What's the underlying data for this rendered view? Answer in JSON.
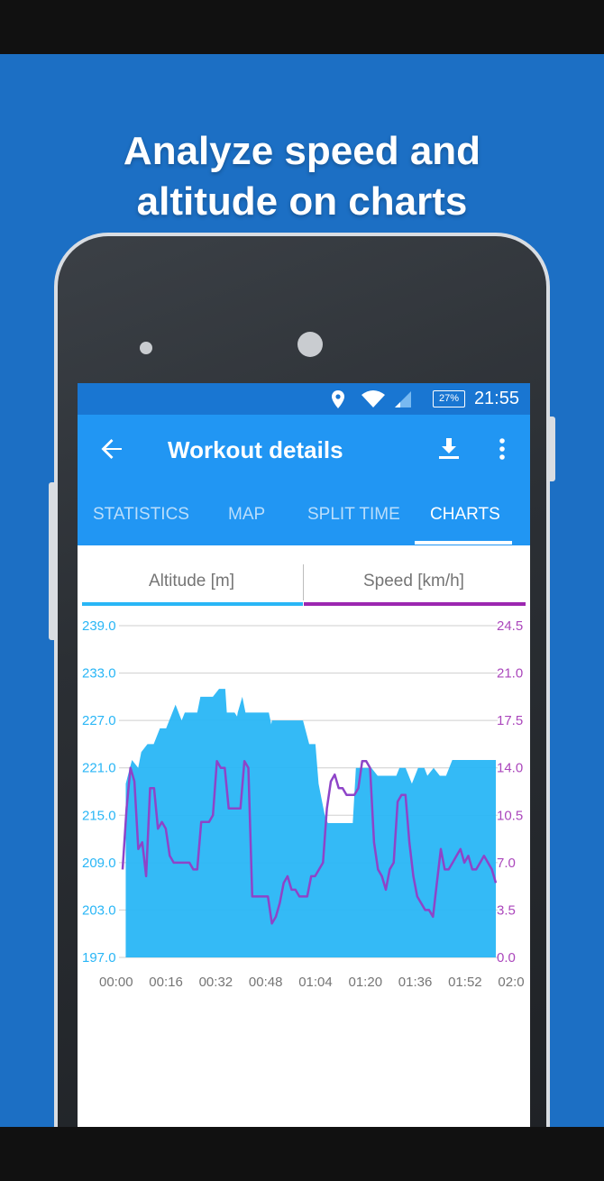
{
  "promo": {
    "headline_line1": "Analyze speed and",
    "headline_line2": "altitude on charts"
  },
  "status_bar": {
    "battery": "27%",
    "time": "21:55"
  },
  "app_bar": {
    "title": "Workout details",
    "tabs": [
      {
        "label": "STATISTICS",
        "active": false
      },
      {
        "label": "MAP",
        "active": false
      },
      {
        "label": "SPLIT TIME",
        "active": false
      },
      {
        "label": "CHARTS",
        "active": true
      }
    ]
  },
  "chart_toggle": {
    "altitude_label": "Altitude [m]",
    "speed_label": "Speed [km/h]"
  },
  "colors": {
    "brand": "#1c6fc4",
    "app_bar": "#2196f3",
    "altitude": "#29b6f6",
    "speed": "#9c27b0"
  },
  "chart_data": {
    "type": "area",
    "title": "",
    "x_ticks": [
      "00:00",
      "00:16",
      "00:32",
      "00:48",
      "01:04",
      "01:20",
      "01:36",
      "01:52",
      "02:0"
    ],
    "y_left_ticks": [
      "239.0",
      "233.0",
      "227.0",
      "221.0",
      "215.0",
      "209.0",
      "203.0",
      "197.0"
    ],
    "y_right_ticks": [
      "24.5",
      "21.0",
      "17.5",
      "14.0",
      "10.5",
      "7.0",
      "3.5",
      "0.0"
    ],
    "y_left_range": [
      197,
      239
    ],
    "y_right_range": [
      0,
      24.5
    ],
    "x_range_minutes": [
      0,
      120
    ],
    "grid": true,
    "series": [
      {
        "name": "Altitude [m]",
        "axis": "left",
        "kind": "area",
        "points": [
          [
            1,
            219
          ],
          [
            3,
            222
          ],
          [
            5,
            221
          ],
          [
            6,
            223
          ],
          [
            8,
            224
          ],
          [
            10,
            224
          ],
          [
            12,
            226
          ],
          [
            14,
            226
          ],
          [
            17,
            229
          ],
          [
            19,
            227
          ],
          [
            20,
            228
          ],
          [
            22,
            228
          ],
          [
            24,
            228
          ],
          [
            25,
            230
          ],
          [
            27,
            230
          ],
          [
            29,
            230
          ],
          [
            31,
            231
          ],
          [
            33,
            231
          ],
          [
            33.5,
            228
          ],
          [
            36,
            228
          ],
          [
            36.8,
            227.5
          ],
          [
            37,
            228
          ],
          [
            38.5,
            230
          ],
          [
            39.5,
            228
          ],
          [
            42,
            228
          ],
          [
            44,
            228
          ],
          [
            46,
            228
          ],
          [
            47,
            228
          ],
          [
            47.8,
            226.5
          ],
          [
            48,
            227
          ],
          [
            50,
            227
          ],
          [
            52,
            227
          ],
          [
            54,
            227
          ],
          [
            55,
            227
          ],
          [
            58,
            227
          ],
          [
            60,
            224
          ],
          [
            62,
            224
          ],
          [
            63,
            219
          ],
          [
            64,
            217
          ],
          [
            65,
            215
          ],
          [
            66,
            214
          ],
          [
            68,
            214
          ],
          [
            70,
            214
          ],
          [
            72,
            214
          ],
          [
            74,
            214
          ],
          [
            75,
            221
          ],
          [
            77,
            221
          ],
          [
            80,
            221
          ],
          [
            82,
            220
          ],
          [
            84,
            220
          ],
          [
            86,
            220
          ],
          [
            88,
            220
          ],
          [
            89,
            221
          ],
          [
            91,
            221
          ],
          [
            92,
            220
          ],
          [
            93,
            219
          ],
          [
            95,
            221
          ],
          [
            97,
            221
          ],
          [
            98,
            220
          ],
          [
            100,
            221
          ],
          [
            102,
            220
          ],
          [
            104,
            220
          ],
          [
            106,
            222
          ],
          [
            110,
            222
          ],
          [
            120,
            222
          ]
        ]
      },
      {
        "name": "Speed [km/h]",
        "axis": "right",
        "kind": "line",
        "points": [
          [
            0,
            6.5
          ],
          [
            1,
            11
          ],
          [
            2,
            14
          ],
          [
            3,
            13
          ],
          [
            4,
            8
          ],
          [
            5,
            8.5
          ],
          [
            6,
            6
          ],
          [
            7,
            12.5
          ],
          [
            9,
            12.5
          ],
          [
            10,
            9.5
          ],
          [
            11,
            10
          ],
          [
            12,
            9.5
          ],
          [
            13,
            7.5
          ],
          [
            15,
            7
          ],
          [
            17,
            7
          ],
          [
            20,
            7
          ],
          [
            22,
            7
          ],
          [
            24,
            7
          ],
          [
            25,
            6.5
          ],
          [
            26,
            6.5
          ],
          [
            27,
            10
          ],
          [
            30,
            10
          ],
          [
            33,
            10
          ],
          [
            34,
            10.5
          ],
          [
            36,
            14.5
          ],
          [
            37,
            14
          ],
          [
            38,
            14
          ],
          [
            39,
            11
          ],
          [
            41,
            11
          ],
          [
            43,
            11
          ],
          [
            46,
            11
          ],
          [
            48,
            14.5
          ],
          [
            49,
            14
          ],
          [
            50,
            4.5
          ],
          [
            52,
            4.5
          ],
          [
            55,
            4.5
          ],
          [
            58,
            4.5
          ],
          [
            60,
            4.5
          ],
          [
            61,
            2.5
          ],
          [
            62,
            3
          ],
          [
            63,
            4
          ],
          [
            65,
            5.5
          ],
          [
            66,
            6
          ],
          [
            67,
            5
          ],
          [
            68,
            5
          ],
          [
            70,
            4.5
          ],
          [
            72,
            4.5
          ],
          [
            74,
            4.5
          ],
          [
            75,
            6
          ],
          [
            77,
            6
          ],
          [
            78,
            6.5
          ],
          [
            80,
            7
          ],
          [
            82,
            11
          ],
          [
            84,
            13
          ],
          [
            86,
            13.5
          ],
          [
            88,
            12.5
          ],
          [
            90,
            12.5
          ],
          [
            92,
            12
          ],
          [
            94,
            12
          ],
          [
            96,
            12
          ],
          [
            98,
            12.5
          ],
          [
            99,
            14.5
          ],
          [
            101,
            14.5
          ],
          [
            102,
            14
          ],
          [
            103,
            8.5
          ],
          [
            104,
            6.5
          ],
          [
            105,
            6
          ],
          [
            107,
            5
          ],
          [
            109,
            6.5
          ],
          [
            110,
            7
          ],
          [
            112,
            11.5
          ],
          [
            114,
            12
          ],
          [
            116,
            12
          ],
          [
            118,
            8.5
          ],
          [
            120,
            6
          ],
          [
            122,
            4.5
          ],
          [
            123,
            4
          ],
          [
            124,
            3.5
          ],
          [
            125,
            3.5
          ],
          [
            126,
            3
          ],
          [
            127,
            5.5
          ],
          [
            128,
            8
          ],
          [
            129,
            6.5
          ],
          [
            130,
            6.5
          ],
          [
            132,
            7
          ],
          [
            134,
            7.5
          ],
          [
            135,
            8
          ],
          [
            136,
            7
          ],
          [
            137,
            7.5
          ],
          [
            138,
            6.5
          ],
          [
            139,
            6.5
          ],
          [
            140,
            7
          ],
          [
            141,
            7.5
          ],
          [
            142,
            7
          ],
          [
            143,
            6.5
          ],
          [
            144,
            5.5
          ]
        ]
      }
    ]
  }
}
